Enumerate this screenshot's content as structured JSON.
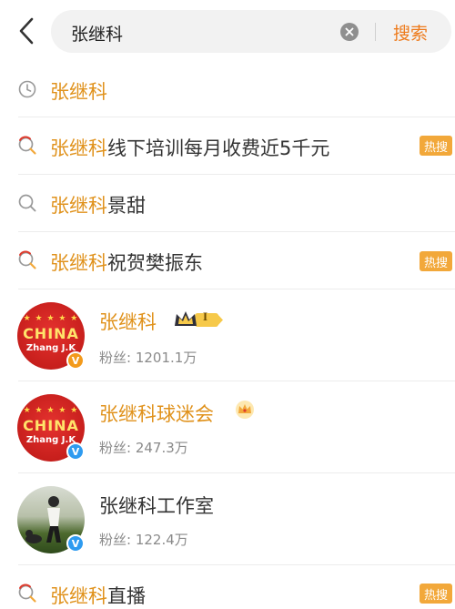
{
  "search": {
    "query": "张继科",
    "button_label": "搜索"
  },
  "icons": {
    "back": "chevron-left-icon",
    "clear": "clear-circle-icon",
    "history": "clock-icon",
    "search": "search-icon",
    "hot_search": "hot-search-icon",
    "crown": "crown-icon",
    "verified": "verified-badge-icon"
  },
  "colors": {
    "accent": "#ee7b1c",
    "highlight": "#e0921c",
    "hot_badge": "#f2a83a",
    "verify_orange": "#f39a1b",
    "verify_blue": "#2e9bf0"
  },
  "suggestions": [
    {
      "type": "history",
      "highlight": "张继科",
      "rest": "",
      "badge": ""
    },
    {
      "type": "hot",
      "highlight": "张继科",
      "rest": "线下培训每月收费近5千元",
      "badge": "热搜"
    },
    {
      "type": "search",
      "highlight": "张继科",
      "rest": "景甜",
      "badge": ""
    },
    {
      "type": "hot",
      "highlight": "张继科",
      "rest": "祝贺樊振东",
      "badge": "热搜"
    }
  ],
  "users": [
    {
      "name": "张继科",
      "fans_label": "粉丝:",
      "fans": "1201.1万",
      "level": "I",
      "avatar_text": "CHINA",
      "avatar_sub": "Zhang J.K"
    },
    {
      "name": "张继科球迷会",
      "fans_label": "粉丝:",
      "fans": "247.3万",
      "avatar_text": "CHINA",
      "avatar_sub": "Zhang J.K"
    },
    {
      "name": "张继科工作室",
      "fans_label": "粉丝:",
      "fans": "122.4万"
    }
  ],
  "last_suggestion": {
    "type": "hot",
    "highlight": "张继科",
    "rest": "直播",
    "badge": "热搜"
  }
}
